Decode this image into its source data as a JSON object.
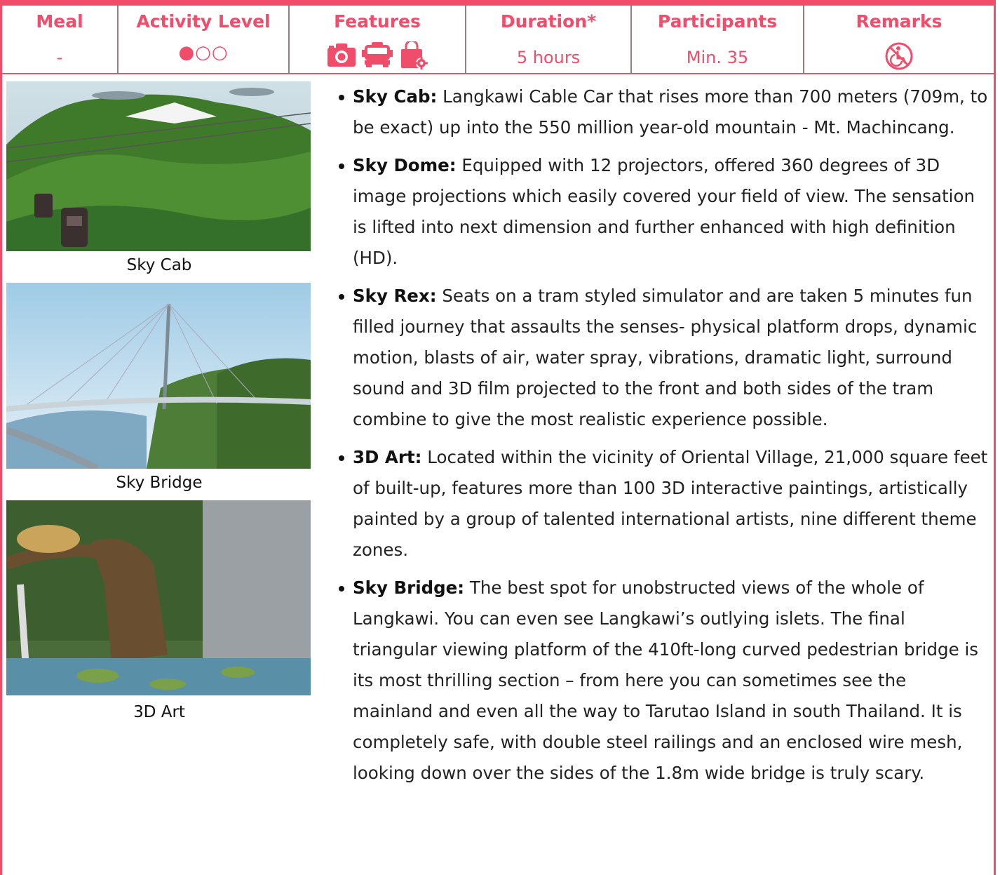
{
  "header": {
    "columns": [
      {
        "label": "Meal",
        "value": "-"
      },
      {
        "label": "Activity Level",
        "value": "●○○"
      },
      {
        "label": "Features",
        "icons": [
          "camera-icon",
          "bus-icon",
          "shopping-bag-icon"
        ]
      },
      {
        "label": "Duration*",
        "value": "5 hours"
      },
      {
        "label": "Participants",
        "value": "Min. 35"
      },
      {
        "label": "Remarks",
        "icons": [
          "no-wheelchair-icon"
        ]
      }
    ]
  },
  "photos": [
    {
      "caption": "Sky Cab"
    },
    {
      "caption": "Sky Bridge"
    },
    {
      "caption": "3D Art"
    }
  ],
  "items": [
    {
      "term": "Sky Cab:",
      "text": " Langkawi Cable Car that rises more than 700 meters (709m, to be exact) up into the 550 million year-old mountain - Mt. Machincang."
    },
    {
      "term": "Sky Dome:",
      "text": " Equipped with 12 projectors, offered 360 degrees of 3D image projections which easily covered your field of view. The sensation is lifted into next dimension and further enhanced with high definition (HD)."
    },
    {
      "term": "Sky Rex:",
      "text": " Seats on a tram styled simulator and are taken 5 minutes fun filled journey that assaults the senses- physical platform drops, dynamic motion, blasts of air, water spray, vibrations, dramatic light, surround sound and 3D film projected to the front and both sides of the tram combine to give the most realistic experience possible."
    },
    {
      "term": "3D Art:",
      "text": " Located within the vicinity of Oriental Village, 21,000 square feet of built-up, features more than 100 3D interactive paintings, artistically painted by a group of talented international artists, nine different theme zones."
    },
    {
      "term": "Sky Bridge:",
      "text": " The best spot for unobstructed views of the whole of Langkawi. You can even see Langkawi’s outlying islets. The final triangular viewing platform of the 410ft-long curved pedestrian bridge is its most thrilling section – from here you can sometimes see the mainland and even all the way to Tarutao Island in south Thailand. It is completely safe, with double steel railings and an enclosed wire mesh, looking down over the sides of the 1.8m wide bridge is truly scary."
    }
  ],
  "colors": {
    "accent": "#f04d6b"
  }
}
